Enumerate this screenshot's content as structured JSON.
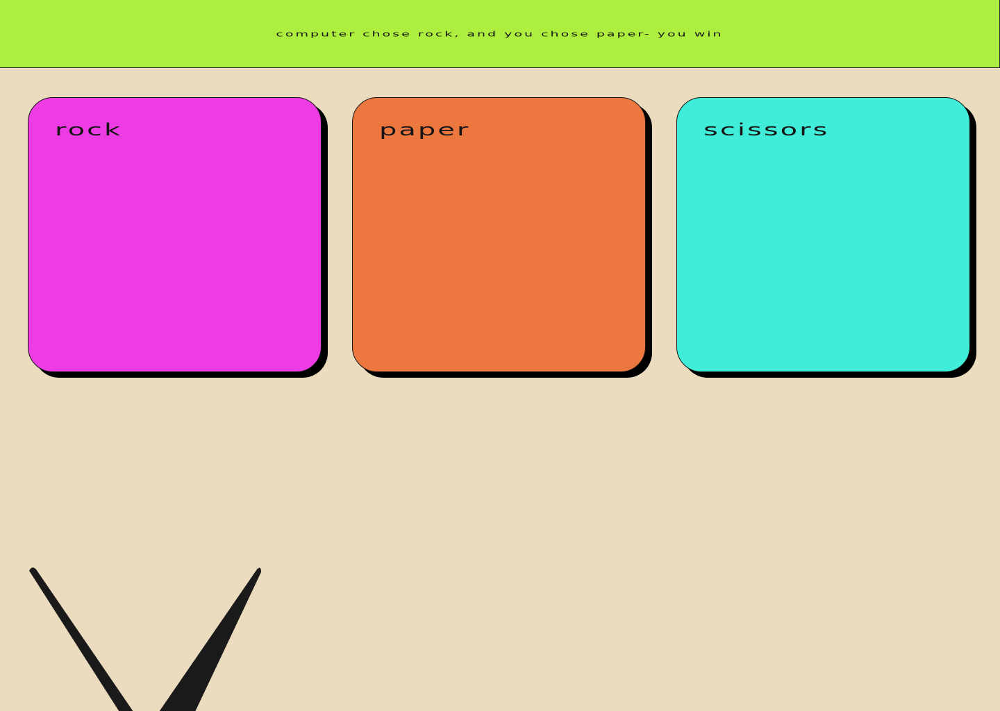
{
  "banner": {
    "message": "computer chose rock, and you chose paper- you win"
  },
  "choices": [
    {
      "id": "rock",
      "label": "rock",
      "color": "#ee3ce4"
    },
    {
      "id": "paper",
      "label": "paper",
      "color": "#ec783f"
    },
    {
      "id": "scissors",
      "label": "scissors",
      "color": "#40edd9"
    }
  ],
  "colors": {
    "background": "#ebdcbf",
    "banner": "#aeee3f",
    "text": "#161616"
  },
  "icons": {
    "result_mark": "v-shape-icon"
  }
}
